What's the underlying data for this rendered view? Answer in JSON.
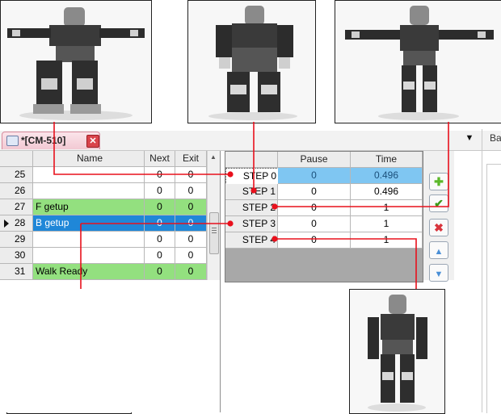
{
  "tab": {
    "title": "*[CM-510]",
    "close": "✕",
    "icon": "window-icon"
  },
  "dropdown_arrow": "▼",
  "side_panel_label": "Ba",
  "motion_list": {
    "headers": {
      "index": "",
      "name": "Name",
      "next": "Next",
      "exit": "Exit"
    },
    "rows": [
      {
        "index": "25",
        "name": "",
        "next": "0",
        "exit": "0",
        "state": "normal"
      },
      {
        "index": "26",
        "name": "",
        "next": "0",
        "exit": "0",
        "state": "normal"
      },
      {
        "index": "27",
        "name": "F getup",
        "next": "0",
        "exit": "0",
        "state": "green"
      },
      {
        "index": "28",
        "name": "B getup",
        "next": "0",
        "exit": "0",
        "state": "selected"
      },
      {
        "index": "29",
        "name": "",
        "next": "0",
        "exit": "0",
        "state": "normal"
      },
      {
        "index": "30",
        "name": "",
        "next": "0",
        "exit": "0",
        "state": "normal"
      },
      {
        "index": "31",
        "name": "Walk Ready",
        "next": "0",
        "exit": "0",
        "state": "green"
      }
    ]
  },
  "step_table": {
    "headers": {
      "step": "",
      "pause": "Pause",
      "time": "Time"
    },
    "rows": [
      {
        "step": "STEP 0",
        "pause": "0",
        "time": "0.496",
        "selected": true
      },
      {
        "step": "STEP 1",
        "pause": "0",
        "time": "0.496",
        "selected": false
      },
      {
        "step": "STEP 2",
        "pause": "0",
        "time": "1",
        "selected": false
      },
      {
        "step": "STEP 3",
        "pause": "0",
        "time": "1",
        "selected": false
      },
      {
        "step": "STEP 4",
        "pause": "0",
        "time": "1",
        "selected": false
      }
    ]
  },
  "tool_buttons": [
    {
      "name": "add-step-button",
      "glyph": "✚",
      "color": "#5cb82a"
    },
    {
      "name": "apply-step-button",
      "glyph": "✔",
      "color": "#3d9a1a"
    },
    {
      "name": "delete-step-button",
      "glyph": "✖",
      "color": "#d8343c"
    },
    {
      "name": "move-up-button",
      "glyph": "▲",
      "color": "#4a8fd6"
    },
    {
      "name": "move-down-button",
      "glyph": "▼",
      "color": "#4a8fd6"
    }
  ],
  "colors": {
    "connector": "#e8101c",
    "green_row": "#93e07f",
    "selected_row": "#1f87d8",
    "selected_step": "#7fc6f2"
  },
  "photos": [
    {
      "name": "photo-robot-pose-step-0",
      "pose": "arms-out-crouch"
    },
    {
      "name": "photo-robot-pose-step-1",
      "pose": "kneeling"
    },
    {
      "name": "photo-robot-pose-step-2",
      "pose": "t-pose-standing"
    },
    {
      "name": "photo-robot-pose-step-3",
      "pose": "standing-arms-down"
    },
    {
      "name": "photo-robot-pose-step-4",
      "pose": "standing-ready"
    }
  ]
}
